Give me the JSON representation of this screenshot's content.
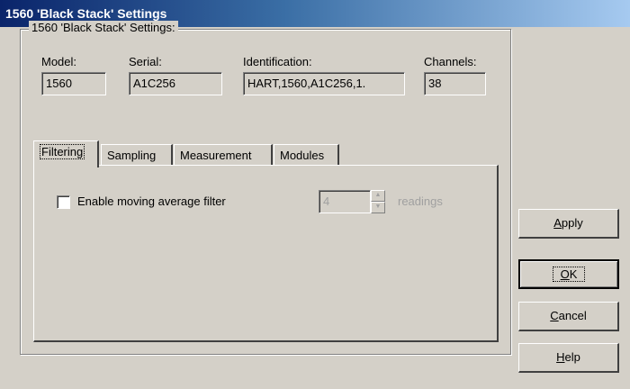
{
  "window": {
    "title": "1560 'Black Stack' Settings"
  },
  "group": {
    "legend": "1560 'Black Stack' Settings:"
  },
  "info": {
    "model_label": "Model:",
    "model_value": "1560",
    "serial_label": "Serial:",
    "serial_value": "A1C256",
    "identification_label": "Identification:",
    "identification_value": "HART,1560,A1C256,1.",
    "channels_label": "Channels:",
    "channels_value": "38"
  },
  "tabs": [
    {
      "label": "Filtering",
      "active": true
    },
    {
      "label": "Sampling",
      "active": false
    },
    {
      "label": "Measurement",
      "active": false
    },
    {
      "label": "Modules",
      "active": false
    }
  ],
  "filtering": {
    "checkbox_label": "Enable moving average filter",
    "checkbox_checked": false,
    "readings_value": "4",
    "readings_label": "readings"
  },
  "buttons": {
    "apply": {
      "before": "",
      "mnemonic": "A",
      "after": "pply"
    },
    "ok": {
      "before": "",
      "mnemonic": "O",
      "after": "K"
    },
    "cancel": {
      "before": "",
      "mnemonic": "C",
      "after": "ancel"
    },
    "help": {
      "before": "",
      "mnemonic": "H",
      "after": "elp"
    }
  },
  "colors": {
    "titlebar_start": "#0a246a",
    "titlebar_end": "#a6caf0",
    "face": "#d4d0c8"
  }
}
